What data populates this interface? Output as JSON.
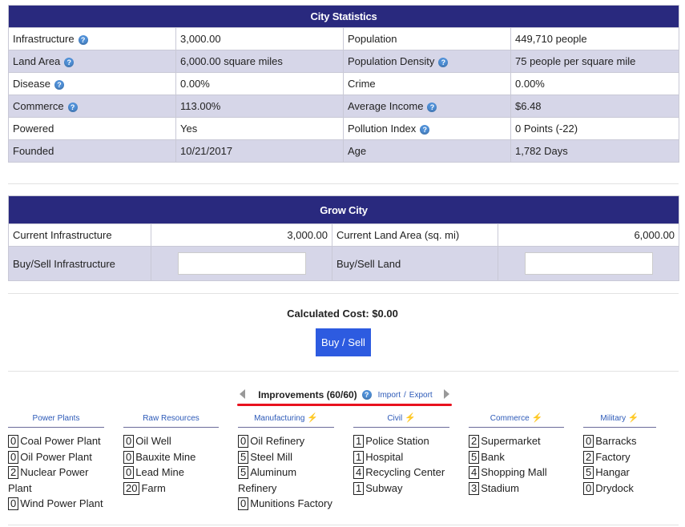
{
  "city_statistics": {
    "title": "City Statistics",
    "rows": [
      {
        "l_label": "Infrastructure",
        "l_value": "3,000.00",
        "r_label": "Population",
        "r_value": "449,710 people"
      },
      {
        "l_label": "Land Area",
        "l_value": "6,000.00 square miles",
        "r_label": "Population Density",
        "r_value": "75 people per square mile"
      },
      {
        "l_label": "Disease",
        "l_value": "0.00%",
        "r_label": "Crime",
        "r_value": "0.00%"
      },
      {
        "l_label": "Commerce",
        "l_value": "113.00%",
        "r_label": "Average Income",
        "r_value": "$6.48"
      },
      {
        "l_label": "Powered",
        "l_value": "Yes",
        "r_label": "Pollution Index",
        "r_value": "0 Points (-22)"
      },
      {
        "l_label": "Founded",
        "l_value": "10/21/2017",
        "r_label": "Age",
        "r_value": "1,782 Days"
      }
    ]
  },
  "grow_city": {
    "title": "Grow City",
    "current_infra_label": "Current Infrastructure",
    "current_infra_value": "3,000.00",
    "current_land_label": "Current Land Area (sq. mi)",
    "current_land_value": "6,000.00",
    "buy_infra_label": "Buy/Sell Infrastructure",
    "buy_infra_value": "",
    "buy_land_label": "Buy/Sell Land",
    "buy_land_value": ""
  },
  "cost": {
    "label": "Calculated Cost: $0.00"
  },
  "buy_button": {
    "label": "Buy / Sell"
  },
  "improvements": {
    "title": "Improvements (60/60)",
    "import_label": "Import",
    "separator": "/",
    "export_label": "Export",
    "categories": [
      {
        "name": "Power Plants",
        "items": [
          {
            "count": "0",
            "name": "Coal Power Plant"
          },
          {
            "count": "0",
            "name": "Oil Power Plant"
          },
          {
            "count": "2",
            "name": "Nuclear Power Plant"
          },
          {
            "count": "0",
            "name": "Wind Power Plant"
          }
        ]
      },
      {
        "name": "Raw Resources",
        "items": [
          {
            "count": "0",
            "name": "Oil Well"
          },
          {
            "count": "0",
            "name": "Bauxite Mine"
          },
          {
            "count": "0",
            "name": "Lead Mine"
          },
          {
            "count": "20",
            "name": "Farm"
          }
        ]
      },
      {
        "name": "Manufacturing",
        "items": [
          {
            "count": "0",
            "name": "Oil Refinery"
          },
          {
            "count": "5",
            "name": "Steel Mill"
          },
          {
            "count": "5",
            "name": "Aluminum Refinery"
          },
          {
            "count": "0",
            "name": "Munitions Factory"
          }
        ]
      },
      {
        "name": "Civil",
        "items": [
          {
            "count": "1",
            "name": "Police Station"
          },
          {
            "count": "1",
            "name": "Hospital"
          },
          {
            "count": "4",
            "name": "Recycling Center"
          },
          {
            "count": "1",
            "name": "Subway"
          }
        ]
      },
      {
        "name": "Commerce",
        "items": [
          {
            "count": "2",
            "name": "Supermarket"
          },
          {
            "count": "5",
            "name": "Bank"
          },
          {
            "count": "4",
            "name": "Shopping Mall"
          },
          {
            "count": "3",
            "name": "Stadium"
          }
        ]
      },
      {
        "name": "Military",
        "items": [
          {
            "count": "0",
            "name": "Barracks"
          },
          {
            "count": "2",
            "name": "Factory"
          },
          {
            "count": "5",
            "name": "Hangar"
          },
          {
            "count": "0",
            "name": "Drydock"
          }
        ]
      }
    ]
  },
  "colors": {
    "header": "#29297e",
    "alt_row": "#d6d6e8",
    "button": "#2d5be0",
    "link": "#2d5ab8",
    "underline": "#e8121e"
  }
}
